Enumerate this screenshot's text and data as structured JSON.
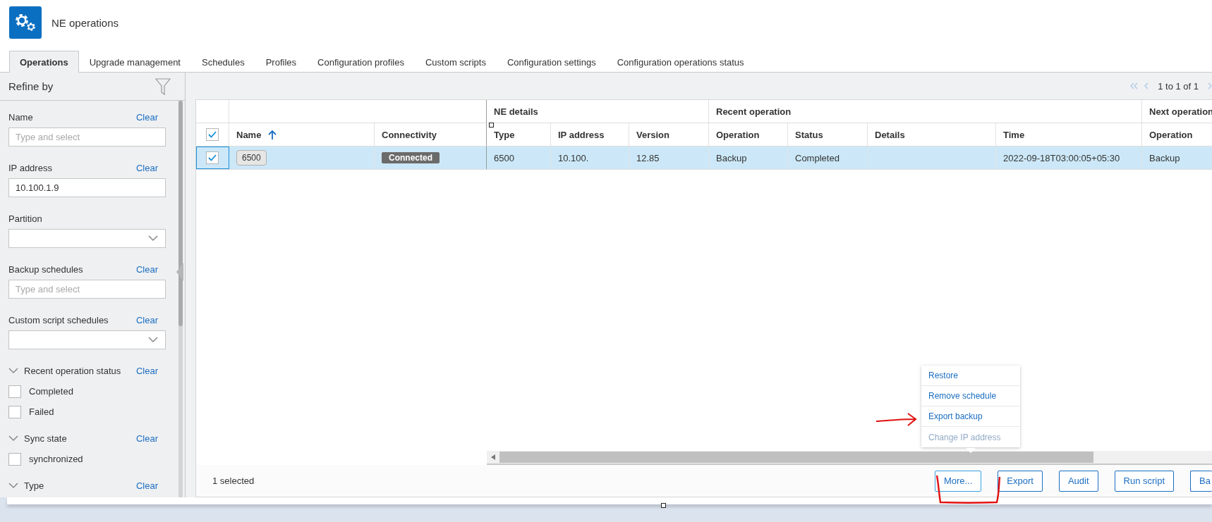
{
  "app": {
    "title": "NE operations"
  },
  "tabs": [
    {
      "label": "Operations",
      "selected": true
    },
    {
      "label": "Upgrade management",
      "selected": false
    },
    {
      "label": "Schedules",
      "selected": false
    },
    {
      "label": "Profiles",
      "selected": false
    },
    {
      "label": "Configuration profiles",
      "selected": false
    },
    {
      "label": "Custom scripts",
      "selected": false
    },
    {
      "label": "Configuration settings",
      "selected": false
    },
    {
      "label": "Configuration operations status",
      "selected": false
    }
  ],
  "sidebar": {
    "title": "Refine by",
    "filters": [
      {
        "kind": "text",
        "label": "Name",
        "clear": "Clear",
        "placeholder": "Type and select"
      },
      {
        "kind": "text",
        "label": "IP address",
        "clear": "Clear",
        "value": "10.100.1.9"
      },
      {
        "kind": "dropdown",
        "label": "Partition"
      },
      {
        "kind": "text",
        "label": "Backup schedules",
        "clear": "Clear",
        "placeholder": "Type and select"
      },
      {
        "kind": "dropdown",
        "label": "Custom script schedules",
        "clear": "Clear"
      },
      {
        "kind": "checklist",
        "label": "Recent operation status",
        "clear": "Clear",
        "expanded": true,
        "options": [
          {
            "label": "Completed",
            "checked": false
          },
          {
            "label": "Failed",
            "checked": false
          }
        ]
      },
      {
        "kind": "checklist",
        "label": "Sync state",
        "clear": "Clear",
        "expanded": true,
        "options": [
          {
            "label": "synchronized",
            "checked": false
          }
        ]
      },
      {
        "kind": "checklist",
        "label": "Type",
        "clear": "Clear",
        "expanded": true
      }
    ]
  },
  "pager": {
    "text": "1 to 1 of 1"
  },
  "table": {
    "all_checked": true,
    "column_groups": [
      {
        "columns": [
          {
            "label": "Name",
            "sorted": true
          },
          {
            "label": "Connectivity"
          }
        ]
      },
      {
        "label": "NE details",
        "columns": [
          {
            "label": "Type"
          },
          {
            "label": "IP address"
          },
          {
            "label": "Version"
          }
        ]
      },
      {
        "label": "Recent operation",
        "columns": [
          {
            "label": "Operation"
          },
          {
            "label": "Status"
          },
          {
            "label": "Details"
          },
          {
            "label": "Time"
          }
        ]
      },
      {
        "label": "Next operation",
        "columns": [
          {
            "label": "Operation"
          }
        ]
      }
    ],
    "rows": [
      {
        "checked": true,
        "selected": true,
        "cells": [
          {
            "kind": "badge",
            "text": "6500"
          },
          {
            "kind": "status",
            "text": "Connected"
          },
          {
            "kind": "text",
            "text": "6500"
          },
          {
            "kind": "text",
            "text": "10.100."
          },
          {
            "kind": "text",
            "text": "12.85"
          },
          {
            "kind": "text",
            "text": "Backup"
          },
          {
            "kind": "text",
            "text": "Completed"
          },
          {
            "kind": "empty"
          },
          {
            "kind": "text",
            "text": "2022-09-18T03:00:05+05:30"
          },
          {
            "kind": "text",
            "text": "Backup"
          }
        ]
      }
    ]
  },
  "context_menu": {
    "items": [
      {
        "label": "Restore",
        "disabled": false
      },
      {
        "label": "Remove schedule",
        "disabled": false
      },
      {
        "label": "Export backup",
        "disabled": false
      },
      {
        "label": "Change IP address",
        "disabled": true
      }
    ]
  },
  "footer": {
    "selection": "1 selected",
    "buttons": [
      "More...",
      "Export",
      "Audit",
      "Run script",
      "Ba"
    ]
  }
}
